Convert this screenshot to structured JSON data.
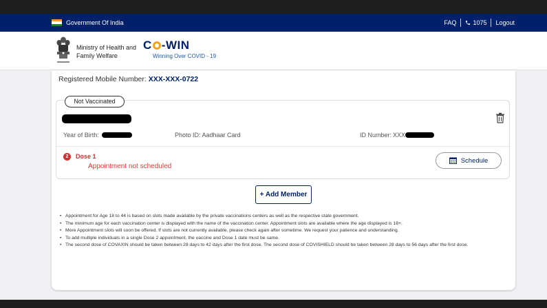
{
  "govbar": {
    "title": "Government Of India",
    "faq": "FAQ",
    "helpline": "1075",
    "logout": "Logout",
    "flag_colors": [
      "#FF9933",
      "#FFFFFF",
      "#138808"
    ]
  },
  "header": {
    "ministry_line1": "Ministry of Health and",
    "ministry_line2": "Family Welfare",
    "brand_prefix": "C",
    "brand_suffix": "-WIN",
    "brand_tagline": "Winning Over COVID - 19"
  },
  "account": {
    "reg_label": "Registered Mobile Number:",
    "reg_value": "XXX-XXX-0722"
  },
  "member": {
    "status_badge": "Not Vaccinated",
    "yob_label": "Year of Birth:",
    "photo_id": "Photo ID: Aadhaar Card",
    "id_number_label": "ID Number:",
    "id_number_prefix": "XXX",
    "dose": {
      "number": "2",
      "label": "Dose 1",
      "status": "Appointment not scheduled"
    },
    "schedule_button": "Schedule"
  },
  "add_member_button": "+ Add Member",
  "notes": [
    "Appointment for Age 18 to 44 is based on slots made available by the private vaccinations centers as well as the respective state government.",
    "The minimum age for each vaccination center is displayed with the name of the vaccination center. Appointment slots are available where the age displayed is 18+.",
    "More Appointment slots will soon be offered. If slots are not currently available, please check again after sometime. We request your patience and understanding.",
    "To add multiple individuals in a single Dose 2 appointment, the vaccine and Dose 1 date must be same.",
    "The second dose of COVAXIN should be taken between 28 days to 42 days after the first dose. The second dose of COVISHIELD should be taken between 28 days to 56 days after the first dose."
  ],
  "colors": {
    "navy": "#002169",
    "alert_red": "#d32f2f",
    "brand_orange": "#f4a21a"
  }
}
